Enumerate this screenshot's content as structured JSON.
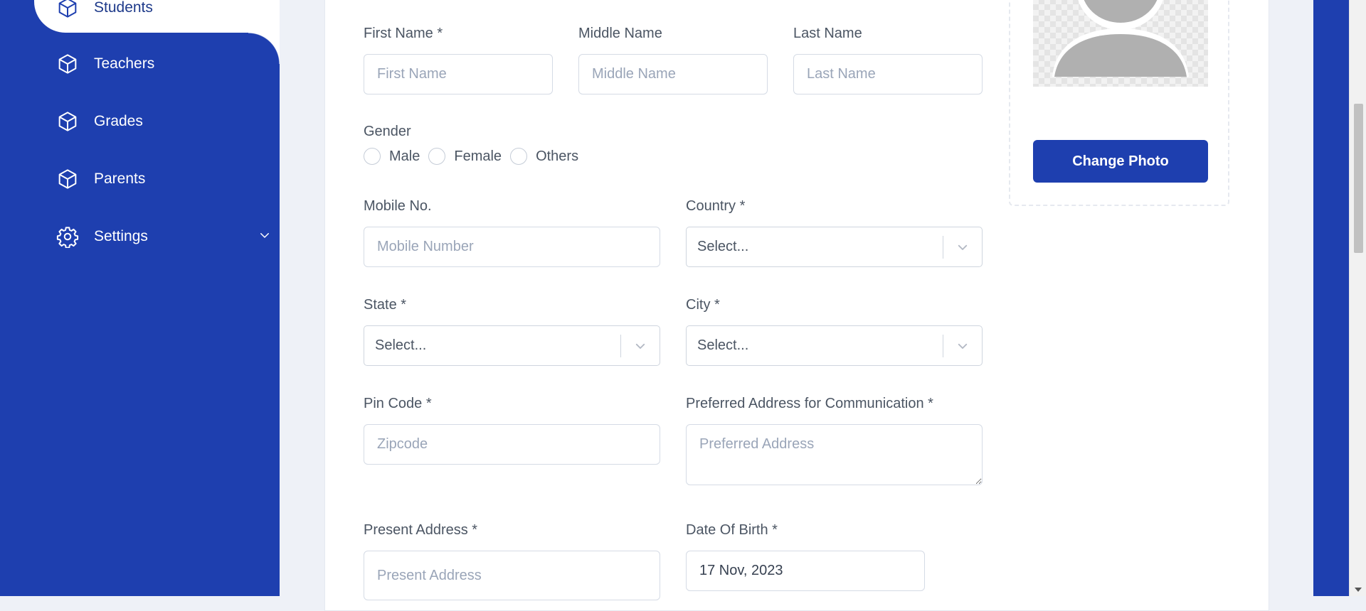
{
  "sidebar": {
    "items": [
      {
        "label": "Students",
        "icon": "cube-icon",
        "active": true
      },
      {
        "label": "Teachers",
        "icon": "cube-icon"
      },
      {
        "label": "Grades",
        "icon": "cube-icon"
      },
      {
        "label": "Parents",
        "icon": "cube-icon"
      },
      {
        "label": "Settings",
        "icon": "gear-icon",
        "has_submenu": true
      }
    ]
  },
  "form": {
    "first_name": {
      "label": "First Name *",
      "placeholder": "First Name"
    },
    "middle_name": {
      "label": "Middle Name",
      "placeholder": "Middle Name"
    },
    "last_name": {
      "label": "Last Name",
      "placeholder": "Last Name"
    },
    "gender": {
      "label": "Gender",
      "options": [
        "Male",
        "Female",
        "Others"
      ]
    },
    "mobile": {
      "label": "Mobile No.",
      "placeholder": "Mobile Number"
    },
    "country": {
      "label": "Country *",
      "value": "Select..."
    },
    "state": {
      "label": "State *",
      "value": "Select..."
    },
    "city": {
      "label": "City *",
      "value": "Select..."
    },
    "pin_code": {
      "label": "Pin Code *",
      "placeholder": "Zipcode"
    },
    "preferred_address": {
      "label": "Preferred Address for Communication *",
      "placeholder": "Preferred Address"
    },
    "present_address": {
      "label": "Present Address *",
      "placeholder": "Present Address"
    },
    "dob": {
      "label": "Date Of Birth *",
      "value": "17 Nov, 2023"
    }
  },
  "photo": {
    "change_label": "Change Photo"
  },
  "colors": {
    "sidebar_bg": "#1e3faf",
    "button_bg": "#1e3faf",
    "page_bg": "#eef1f7"
  }
}
